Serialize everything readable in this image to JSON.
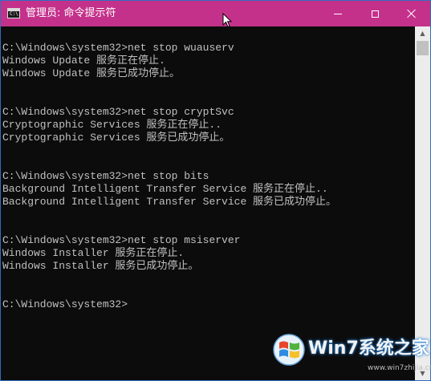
{
  "window": {
    "title": "管理员: 命令提示符",
    "app_icon_text": "C:\\.",
    "title_bar_color": "#c4318b"
  },
  "console": {
    "text_color": "#c0c0c0",
    "background_color": "#0c0c0c",
    "lines": [
      "",
      "C:\\Windows\\system32>net stop wuauserv",
      "Windows Update 服务正在停止.",
      "Windows Update 服务已成功停止。",
      "",
      "",
      "C:\\Windows\\system32>net stop cryptSvc",
      "Cryptographic Services 服务正在停止..",
      "Cryptographic Services 服务已成功停止。",
      "",
      "",
      "C:\\Windows\\system32>net stop bits",
      "Background Intelligent Transfer Service 服务正在停止..",
      "Background Intelligent Transfer Service 服务已成功停止。",
      "",
      "",
      "C:\\Windows\\system32>net stop msiserver",
      "Windows Installer 服务正在停止.",
      "Windows Installer 服务已成功停止。",
      "",
      "",
      "C:\\Windows\\system32>"
    ]
  },
  "controls": {
    "minimize_icon": "minimize-icon",
    "maximize_icon": "maximize-icon",
    "close_icon": "close-icon"
  },
  "watermark": {
    "logo_icon": "windows-logo-icon",
    "brand_text": "Win7系统之家",
    "sub_text": "www.win7zhijia.cn"
  }
}
